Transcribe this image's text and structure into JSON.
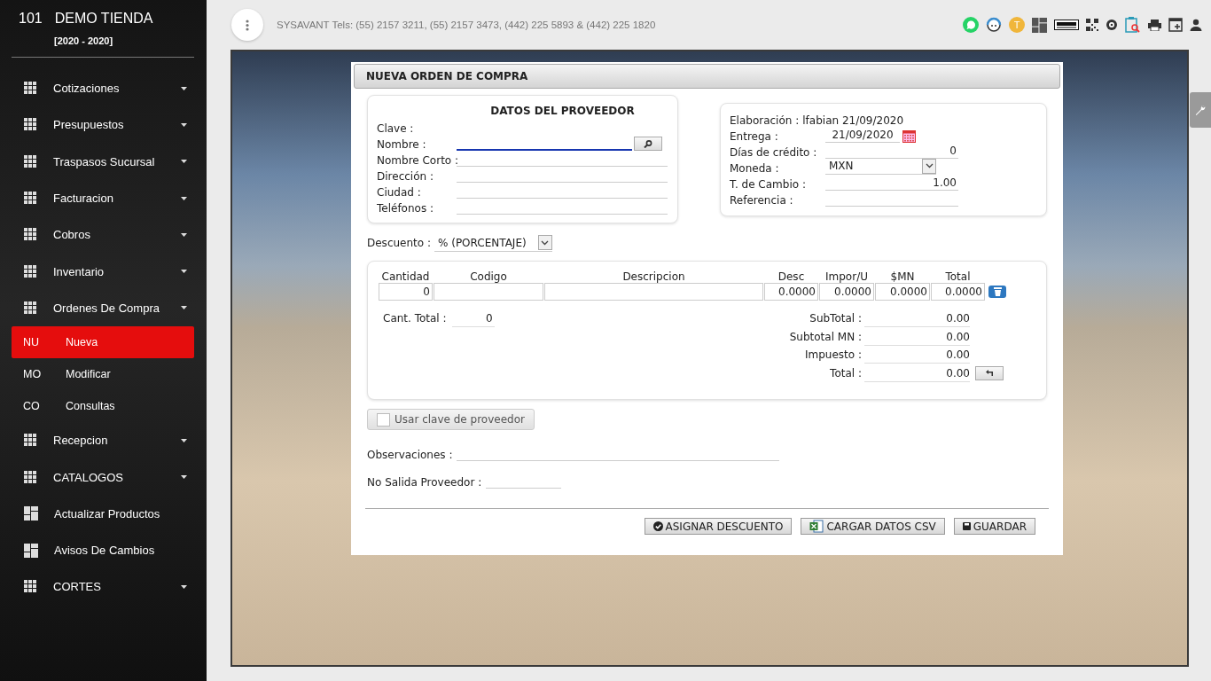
{
  "sidebar": {
    "store_number": "101",
    "store_name": "DEMO TIENDA",
    "period": "[2020 - 2020]",
    "items": [
      {
        "kind": "menu",
        "label": "Cotizaciones"
      },
      {
        "kind": "menu",
        "label": "Presupuestos"
      },
      {
        "kind": "menu",
        "label": "Traspasos Sucursal"
      },
      {
        "kind": "menu",
        "label": "Facturacion"
      },
      {
        "kind": "menu",
        "label": "Cobros"
      },
      {
        "kind": "menu",
        "label": "Inventario"
      },
      {
        "kind": "menu",
        "label": "Ordenes De Compra"
      },
      {
        "kind": "sub",
        "abbr": "NU",
        "label": "Nueva",
        "selected": true
      },
      {
        "kind": "sub",
        "abbr": "MO",
        "label": "Modificar",
        "selected": false
      },
      {
        "kind": "sub",
        "abbr": "CO",
        "label": "Consultas",
        "selected": false
      },
      {
        "kind": "menu",
        "label": "Recepcion"
      },
      {
        "kind": "menu",
        "label": "CATALOGOS"
      },
      {
        "kind": "page",
        "label": "Actualizar Productos"
      },
      {
        "kind": "page",
        "label": "Avisos De Cambios"
      },
      {
        "kind": "menu",
        "label": "CORTES"
      }
    ]
  },
  "header": {
    "contact": "SYSAVANT Tels: (55) 2157 3211, (55) 2157 3473, (442) 225 5893 & (442) 225 1820",
    "user_badge": "T"
  },
  "form": {
    "title": "NUEVA ORDEN DE COMPRA",
    "supplier": {
      "heading": "DATOS DEL PROVEEDOR",
      "fields": [
        {
          "kind": "static",
          "label": "Clave :"
        },
        {
          "kind": "search",
          "label": "Nombre :",
          "focused": true
        },
        {
          "kind": "text",
          "label": "Nombre Corto :",
          "focused": false
        },
        {
          "kind": "text",
          "label": "Dirección :",
          "focused": false
        },
        {
          "kind": "text",
          "label": "Ciudad :",
          "focused": false
        },
        {
          "kind": "text",
          "label": "Teléfonos :",
          "focused": false
        }
      ]
    },
    "order": {
      "fields": [
        {
          "kind": "static",
          "label": "Elaboración :",
          "value": "lfabian 21/09/2020"
        },
        {
          "kind": "date",
          "label": "Entrega :",
          "value": "21/09/2020"
        },
        {
          "kind": "number",
          "label": "Días de crédito :",
          "value": "0"
        },
        {
          "kind": "select",
          "label": "Moneda :",
          "value": "MXN"
        },
        {
          "kind": "number",
          "label": "T. de Cambio :",
          "value": "1.00"
        },
        {
          "kind": "text",
          "label": "Referencia :"
        }
      ]
    },
    "discount": {
      "label": "Descuento :",
      "value": "% (PORCENTAJE)"
    },
    "items": {
      "columns": [
        "Cantidad",
        "Codigo",
        "Descripcion",
        "Desc",
        "Impor/U",
        "$MN",
        "Total"
      ],
      "row": [
        {
          "kind": "number",
          "value": "0"
        },
        {
          "kind": "empty"
        },
        {
          "kind": "empty"
        },
        {
          "kind": "number",
          "value": "0.0000"
        },
        {
          "kind": "number",
          "value": "0.0000"
        },
        {
          "kind": "number",
          "value": "0.0000"
        },
        {
          "kind": "number",
          "value": "0.0000"
        }
      ],
      "count": {
        "label": "Cant. Total :",
        "value": "0"
      },
      "totals": [
        {
          "label": "SubTotal :",
          "value": "0.00"
        },
        {
          "label": "Subtotal MN :",
          "value": "0.00"
        },
        {
          "label": "Impuesto :",
          "value": "0.00"
        },
        {
          "label": "Total :",
          "value": "0.00"
        }
      ]
    },
    "use_supplier_key": {
      "label": "Usar clave de proveedor",
      "checked": false
    },
    "notes": [
      {
        "label": "Observaciones :"
      },
      {
        "label": "No Salida Proveedor :"
      }
    ],
    "buttons": [
      {
        "kind": "confirm",
        "label": "ASIGNAR DESCUENTO"
      },
      {
        "kind": "csv",
        "label": "CARGAR DATOS CSV"
      },
      {
        "kind": "save",
        "label": "GUARDAR"
      }
    ]
  }
}
